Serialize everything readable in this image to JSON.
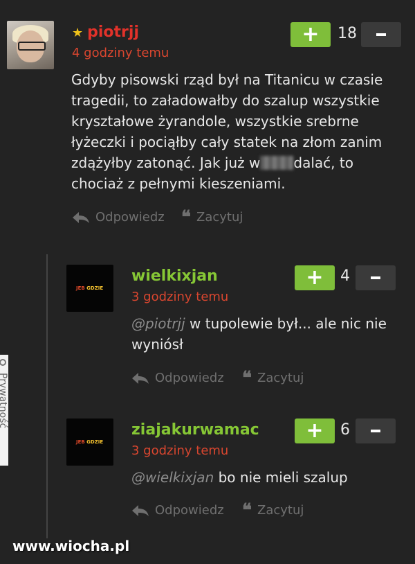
{
  "comments": [
    {
      "username": "piotrjj",
      "star": "★",
      "time": "4 godziny temu",
      "text_lines": [
        "Gdyby pisowski rząd był na Titanicu w czasie",
        "tragedii, to załadowałby do szalup wszystkie",
        "kryształowe żyrandole, wszystkie srebrne",
        "łyżeczki i pociąłby cały statek na złom zanim"
      ],
      "line5_before": "zdążyłby zatonąć. Jak już w",
      "line5_after": "dalać, to",
      "line6": "chociaż z pełnymi kieszeniami.",
      "votes": "18"
    },
    {
      "username": "wielkixjan",
      "time": "3 godziny temu",
      "mention": "@piotrjj",
      "text1": " w tupolewie był... ale nic nie",
      "text2": "wyniósł",
      "votes": "4",
      "avatar_logo_a": "JEB",
      "avatar_logo_b": "GDZIE"
    },
    {
      "username": "ziajakurwamac",
      "time": "3 godziny temu",
      "mention": "@wielkixjan",
      "text1": " bo nie mieli szalup",
      "votes": "6",
      "avatar_logo_a": "JEB",
      "avatar_logo_b": "GDZIE"
    }
  ],
  "actions": {
    "reply": "Odpowiedz",
    "quote": "Zacytuj",
    "plus": "+"
  },
  "side_tab": "Prywatność",
  "watermark": "www.wiocha.pl",
  "colors": {
    "bg": "#232323",
    "plus": "#7fbe3a",
    "minus": "#3a3a3a",
    "red_user": "#e2322a",
    "green_user": "#86c735",
    "time": "#d9462f"
  }
}
